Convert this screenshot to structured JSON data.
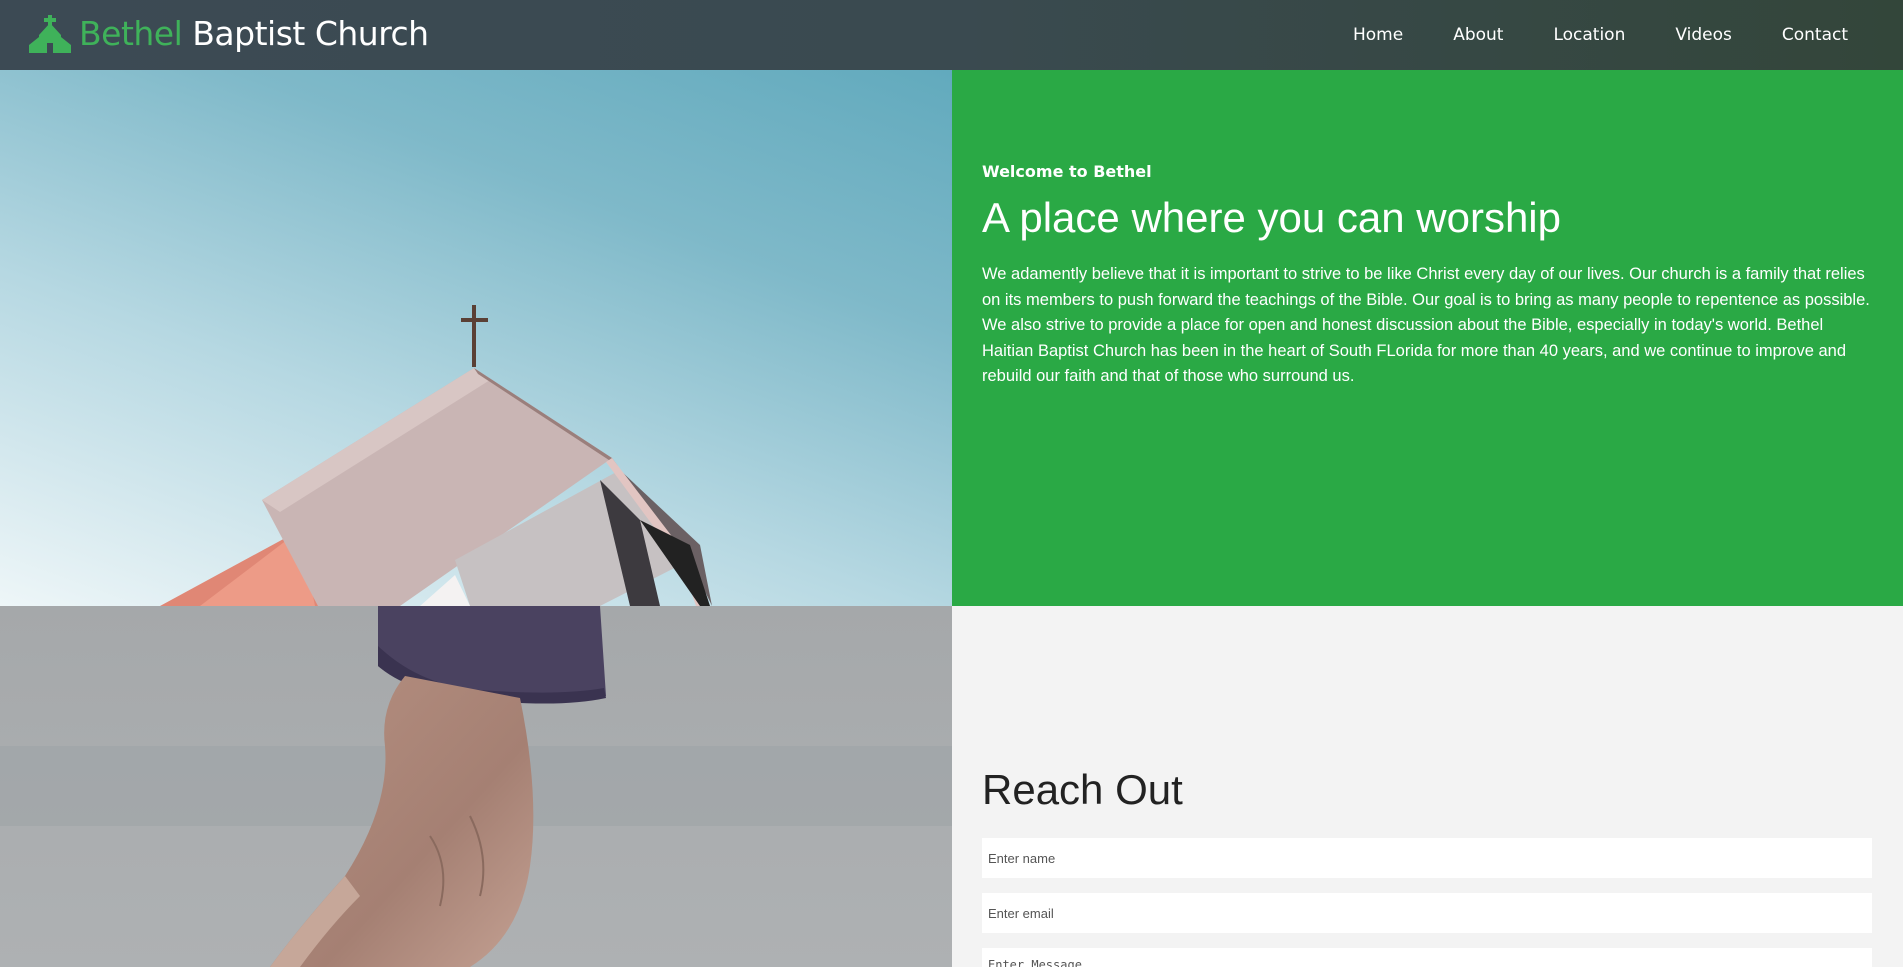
{
  "brand": {
    "accent_word": "Bethel",
    "rest_words": "Baptist Church",
    "icon": "church-icon",
    "accent_color": "#3fb25a"
  },
  "nav": {
    "items": [
      {
        "label": "Home"
      },
      {
        "label": "About"
      },
      {
        "label": "Location"
      },
      {
        "label": "Videos"
      },
      {
        "label": "Contact"
      }
    ]
  },
  "hero": {
    "eyebrow": "Welcome to Bethel",
    "headline": "A place where you can worship",
    "body": "We adamently believe that it is important to strive to be like Christ every day of our lives. Our church is a family that relies on its members to push forward the teachings of the Bible. Our goal is to bring as many people to repentence as possible. We also strive to provide a place for open and honest discussion about the Bible, especially in today's world. Bethel Haitian Baptist Church has been in the heart of South FLorida for more than 40 years, and we continue to improve and rebuild our faith and that of those who surround us.",
    "background_color": "#2aa945"
  },
  "contact": {
    "title": "Reach Out",
    "name_placeholder": "Enter name",
    "email_placeholder": "Enter email",
    "message_placeholder": "Enter Message"
  }
}
